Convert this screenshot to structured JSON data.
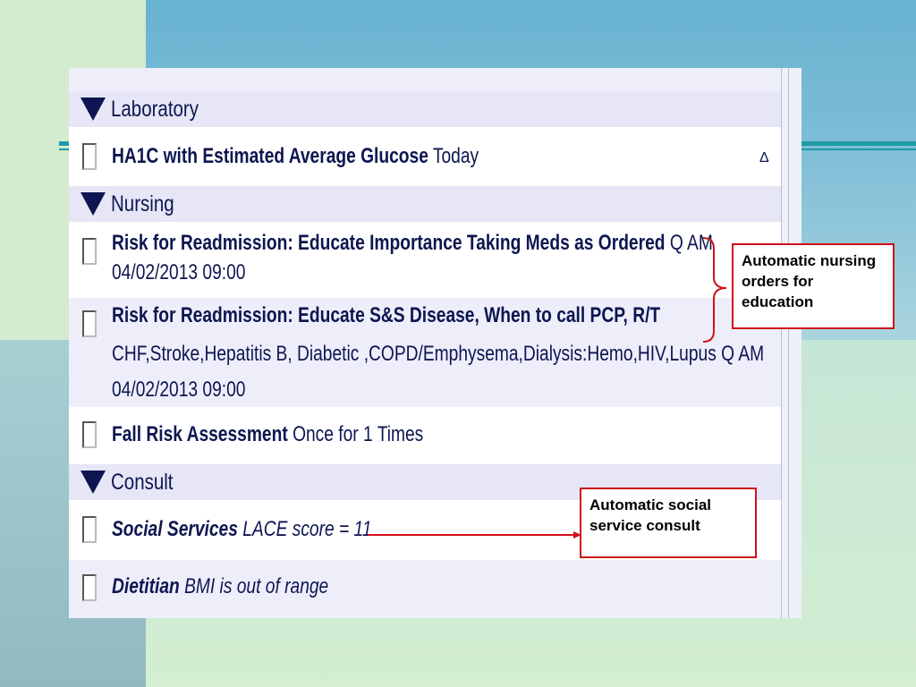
{
  "sections": {
    "laboratory": "Laboratory",
    "nursing": "Nursing",
    "consult": "Consult"
  },
  "orders": {
    "ha1c": {
      "name": "HA1C with Estimated Average Glucose",
      "detail": "Today",
      "marker": "Δ"
    },
    "readmit_meds": {
      "name": "Risk for Readmission: Educate Importance Taking Meds as Ordered",
      "detail": "Q AM",
      "time": "04/02/2013 09:00"
    },
    "readmit_disease": {
      "name": "Risk for Readmission: Educate S&S Disease, When to call PCP, R/T",
      "detail": "CHF,Stroke,Hepatitis B, Diabetic ,COPD/Emphysema,Dialysis:Hemo,HIV,Lupus Q AM",
      "time": "04/02/2013 09:00"
    },
    "fall_risk": {
      "name": "Fall Risk Assessment",
      "detail": "Once for 1 Times"
    },
    "social": {
      "name": "Social Services",
      "detail": "LACE score = 11"
    },
    "dietitian": {
      "name": "Dietitian",
      "detail": "BMI is out of range"
    }
  },
  "callouts": {
    "nursing": "Automatic nursing orders for education",
    "social": "Automatic social service consult"
  },
  "colors": {
    "callout_border": "#d0101a",
    "text": "#0d1650",
    "teal_line": "#1e9aa5"
  }
}
